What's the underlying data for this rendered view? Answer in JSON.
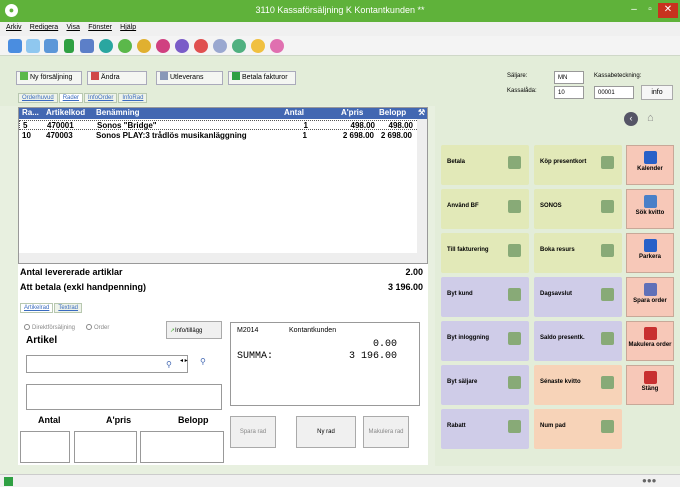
{
  "window": {
    "title": "3110 Kassaförsäljning  K  Kontantkunden **",
    "icon": "app-icon",
    "controls": [
      "minimize-icon",
      "maximize-icon",
      "close-icon"
    ]
  },
  "menu": [
    "Arkiv",
    "Redigera",
    "Visa",
    "Fönster",
    "Hjälp"
  ],
  "actions": {
    "ny_forsaljning": "Ny försäljning",
    "andra": "Ändra",
    "utleverans": "Utleverans",
    "betala_fakturor": "Betala fakturor"
  },
  "tabs": [
    "Orderhuvud",
    "Rader",
    "InfoOrder",
    "InfoRad"
  ],
  "header_info": {
    "saljare_label": "Säljare:",
    "saljare_value": "MN",
    "kassalada_label": "Kassalåda:",
    "kassalada_value": "10",
    "kassabeteckning_label": "Kassabeteckning:",
    "kassabeteckning_value": "00001",
    "info_button": "info"
  },
  "table": {
    "columns": [
      "Ra...",
      "Artikelkod",
      "Benämning",
      "Antal",
      "A'pris",
      "Belopp"
    ],
    "rows": [
      [
        "5",
        "470001",
        "Sonos \"Bridge\"",
        "1",
        "498.00",
        "498.00"
      ],
      [
        "10",
        "470003",
        "Sonos PLAY:3 trådlös musikanläggning",
        "1",
        "2 698.00",
        "2 698.00"
      ]
    ]
  },
  "totals": {
    "antal_label": "Antal levererade artiklar",
    "antal_value": "2.00",
    "betala_label": "Att betala  (exkl handpenning)",
    "betala_value": "3 196.00"
  },
  "lower_tabs": [
    "Artikelrad",
    "Textrad"
  ],
  "entry": {
    "radio1": "Direktförsäljning",
    "radio2": "Order",
    "info_btn": "Info/tillägg",
    "artikel": "Artikel",
    "antal": "Antal",
    "apris": "A'pris",
    "belopp": "Belopp"
  },
  "display": {
    "code": "M2014",
    "customer": "Kontantkunden",
    "line_value": "0.00",
    "summa_label": "SUMMA:",
    "summa_value": "3 196.00"
  },
  "row_buttons": {
    "spara": "Spara rad",
    "ny": "Ny rad",
    "makulera": "Makulera rad"
  },
  "tiles": [
    {
      "label": "Betala",
      "icon": "pay-icon",
      "color": "#e2e9b8"
    },
    {
      "label": "Köp presentkort",
      "icon": "giftcard-icon",
      "color": "#e2e9b8"
    },
    {
      "label": "Använd BF",
      "icon": "bonus-icon",
      "color": "#e2e9b8"
    },
    {
      "label": "SONOS",
      "icon": "sonos-icon",
      "color": "#e2e9b8"
    },
    {
      "label": "Till fakturering",
      "icon": "invoice-icon",
      "color": "#e2e9b8"
    },
    {
      "label": "Boka resurs",
      "icon": "calendar-grid-icon",
      "color": "#e2e9b8"
    },
    {
      "label": "Byt kund",
      "icon": "customer-icon",
      "color": "#cfcce8"
    },
    {
      "label": "Dagsavslut",
      "icon": "day-close-icon",
      "color": "#cfcce8"
    },
    {
      "label": "Byt inloggning",
      "icon": "login-icon",
      "color": "#cfcce8"
    },
    {
      "label": "Saldo presentk.",
      "icon": "giftcard-balance-icon",
      "color": "#cfcce8"
    },
    {
      "label": "Byt säljare",
      "icon": "seller-icon",
      "color": "#cfcce8"
    },
    {
      "label": "Sénaste kvitto",
      "icon": "receipt-icon",
      "color": "#f7d3b8"
    },
    {
      "label": "Rabatt",
      "icon": "discount-icon",
      "color": "#cfcce8"
    },
    {
      "label": "Num pad",
      "icon": "numpad-icon",
      "color": "#f7d3b8"
    }
  ],
  "side_buttons": [
    {
      "label": "Kalender",
      "icon": "calendar-icon"
    },
    {
      "label": "Sök kvitto",
      "icon": "search-receipt-icon"
    },
    {
      "label": "Parkera",
      "icon": "parking-icon"
    },
    {
      "label": "Spara order",
      "icon": "save-order-icon"
    },
    {
      "label": "Makulera order",
      "icon": "cancel-order-icon"
    },
    {
      "label": "Stäng",
      "icon": "close-x-icon"
    }
  ]
}
